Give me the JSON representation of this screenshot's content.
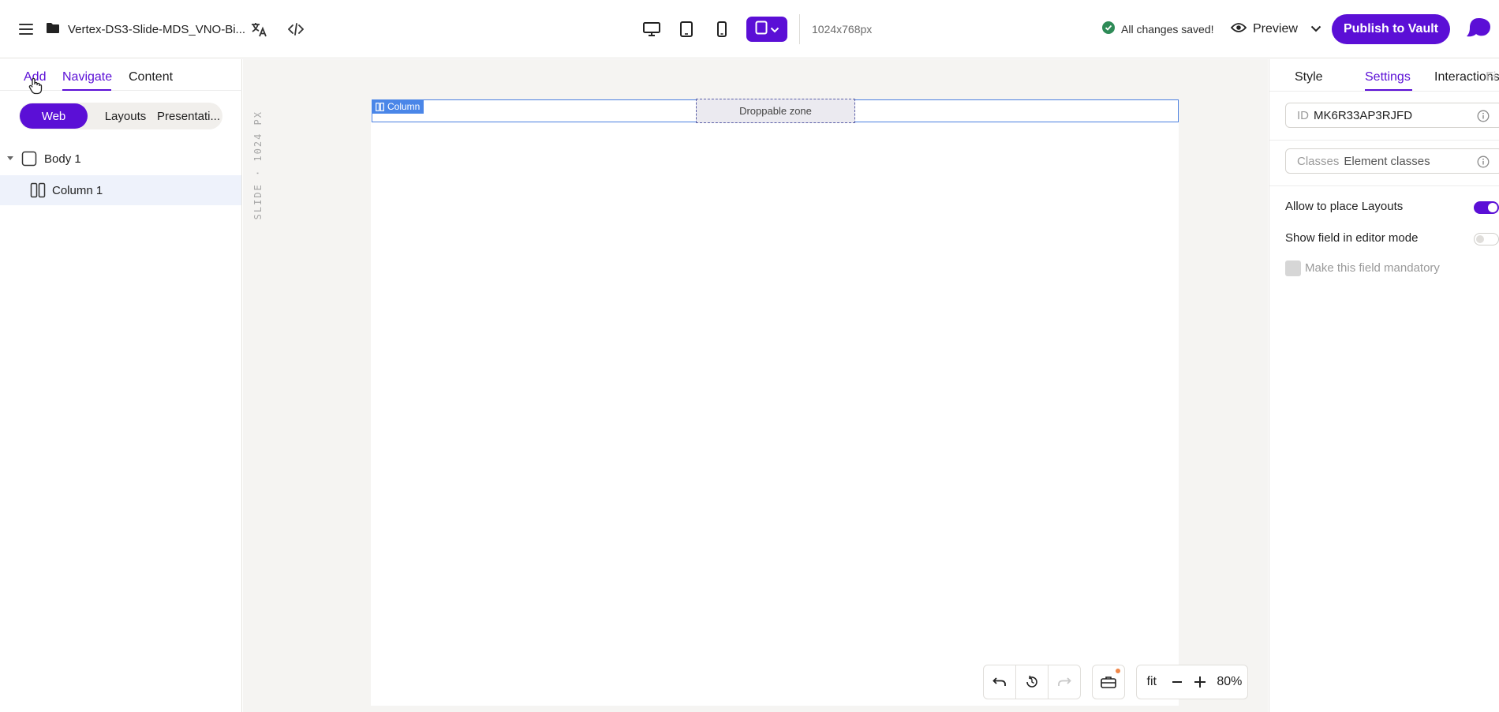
{
  "header": {
    "document_title": "Vertex-DS3-Slide-MDS_VNO-Bi...",
    "resolution": "1024x768px",
    "save_status": "All changes saved!",
    "preview_label": "Preview",
    "publish_label": "Publish to Vault",
    "accent_color": "#5b0fd6"
  },
  "left_panel": {
    "tabs": [
      "Add",
      "Navigate",
      "Content"
    ],
    "active_tab": "Navigate",
    "segments": [
      "Web",
      "Layouts",
      "Presentati..."
    ],
    "active_segment": "Web",
    "tree": [
      {
        "label": "Body 1",
        "icon": "box-icon",
        "expanded": true
      },
      {
        "label": "Column 1",
        "icon": "columns-icon",
        "selected": true
      }
    ]
  },
  "canvas": {
    "ruler_label": "SLIDE · 1024 PX",
    "column_tag": "Column",
    "droppable_zone": "Droppable zone",
    "zoom": {
      "fit_label": "fit",
      "value": "80%"
    }
  },
  "right_panel": {
    "tabs": [
      "Style",
      "Settings",
      "Interactions",
      "Fi"
    ],
    "active_tab": "Settings",
    "id_field": {
      "label": "ID",
      "value": "MK6R33AP3RJFD"
    },
    "classes_field": {
      "label": "Classes",
      "placeholder": "Element classes"
    },
    "options": [
      {
        "label": "Allow to place Layouts",
        "type": "toggle",
        "on": true
      },
      {
        "label": "Show field in editor mode",
        "type": "toggle",
        "on": false
      },
      {
        "label": "Make this field mandatory",
        "type": "checkbox",
        "disabled": true
      }
    ]
  }
}
